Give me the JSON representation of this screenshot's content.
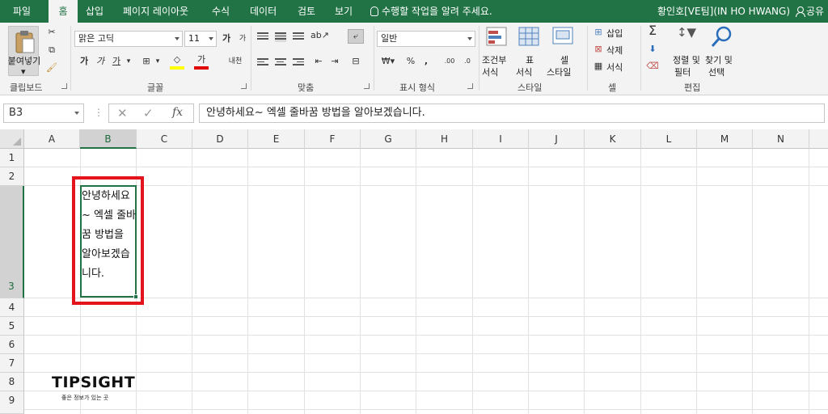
{
  "colors": {
    "accent": "#217346",
    "highlight_box": "#e3141c"
  },
  "tabs": [
    "파일",
    "홈",
    "삽입",
    "페이지 레이아웃",
    "수식",
    "데이터",
    "검토",
    "보기"
  ],
  "active_tab": "홈",
  "tell_me": "수행할 작업을 알려 주세요.",
  "user_name": "황인호[VE팀](IN HO HWANG)",
  "share_label": "공유",
  "ribbon": {
    "clipboard": {
      "label": "클립보드",
      "paste": "붙여넣기"
    },
    "font": {
      "label": "글꼴",
      "font_name": "맑은 고딕",
      "font_size": "11",
      "bold": "가",
      "italic": "가",
      "underline": "가"
    },
    "alignment": {
      "label": "맞춤"
    },
    "number": {
      "label": "표시 형식",
      "format": "일반"
    },
    "styles": {
      "label": "스타일",
      "cond_format": [
        "조건부",
        "서식"
      ],
      "table_format": [
        "표",
        "서식"
      ],
      "cell_styles": [
        "셀",
        "스타일"
      ]
    },
    "cells": {
      "label": "셀",
      "insert": "삽입",
      "delete": "삭제",
      "format": "서식"
    },
    "editing": {
      "label": "편집",
      "sort": [
        "정렬 및",
        "필터"
      ],
      "find": [
        "찾기 및",
        "선택"
      ]
    }
  },
  "formula_bar": {
    "name_box": "B3",
    "fx": "fx",
    "formula": "안녕하세요~ 엑셀 줄바꿈 방법을 알아보겠습니다."
  },
  "columns": [
    "A",
    "B",
    "C",
    "D",
    "E",
    "F",
    "G",
    "H",
    "I",
    "J",
    "K",
    "L",
    "M",
    "N"
  ],
  "selected_column": "B",
  "rows": [
    "1",
    "2",
    "3",
    "4",
    "5",
    "6",
    "7",
    "8",
    "9"
  ],
  "selected_row": "3",
  "cell_b3": "안녕하세요~ 엑셀 줄바꿈 방법을 알아보겠습니다.",
  "logo": {
    "main": "TIPSIGHT",
    "sub": "좋은 정보가 있는 곳"
  }
}
